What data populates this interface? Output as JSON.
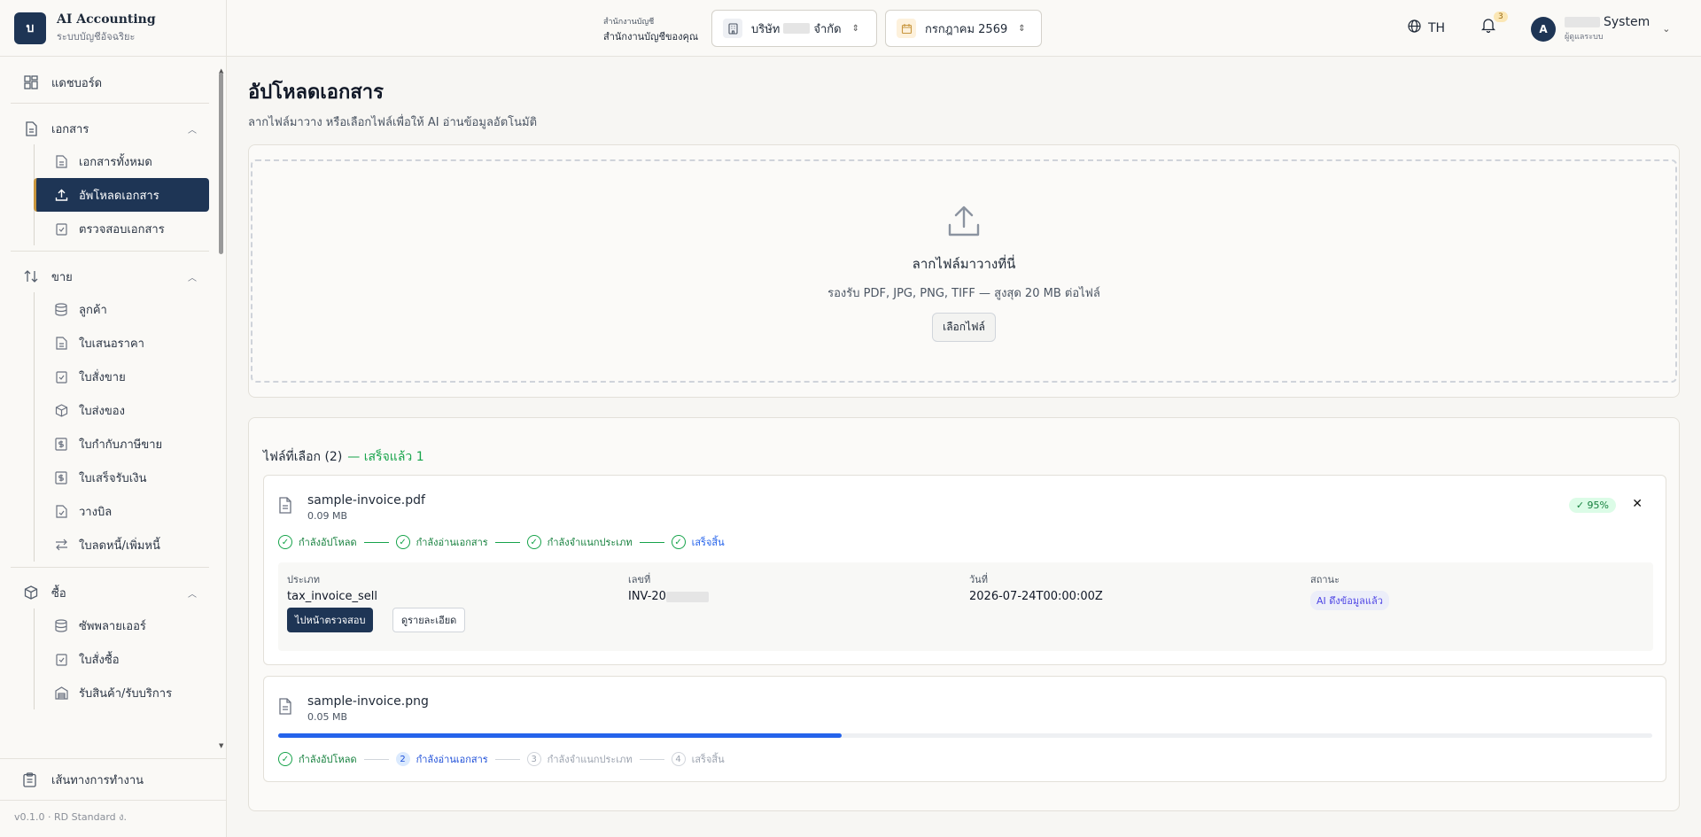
{
  "brand": {
    "logo": "บ",
    "title": "AI Accounting",
    "subtitle": "ระบบบัญชีอัจฉริยะ"
  },
  "sidebar": {
    "dashboard": "แดชบอร์ด",
    "documents": {
      "label": "เอกสาร",
      "items": [
        "เอกสารทั้งหมด",
        "อัพโหลดเอกสาร",
        "ตรวจสอบเอกสาร"
      ]
    },
    "sales": {
      "label": "ขาย",
      "items": [
        "ลูกค้า",
        "ใบเสนอราคา",
        "ใบสั่งขาย",
        "ใบส่งของ",
        "ใบกำกับภาษีขาย",
        "ใบเสร็จรับเงิน",
        "วางบิล",
        "ใบลดหนี้/เพิ่มหนี้"
      ]
    },
    "purchase": {
      "label": "ซื้อ",
      "items": [
        "ซัพพลายเออร์",
        "ใบสั่งซื้อ",
        "รับสินค้า/รับบริการ"
      ]
    },
    "workflow": "เส้นทางการทำงาน",
    "version": "v0.1.0 · RD Standard ง."
  },
  "header": {
    "office_label": "สำนักงานบัญชี",
    "office_name": "สำนักงานบัญชีของคุณ",
    "company_prefix": "บริษัท",
    "company_suffix": "จำกัด",
    "period": "กรกฎาคม 2569",
    "lang": "TH",
    "notif_count": "3",
    "avatar": "A",
    "user_name": "System",
    "user_role": "ผู้ดูแลระบบ"
  },
  "page": {
    "title": "อัปโหลดเอกสาร",
    "subtitle": "ลากไฟล์มาวาง หรือเลือกไฟล์เพื่อให้ AI อ่านข้อมูลอัตโนมัติ"
  },
  "dropzone": {
    "title": "ลากไฟล์มาวางที่นี่",
    "subtitle": "รองรับ PDF, JPG, PNG, TIFF — สูงสุด 20 MB ต่อไฟล์",
    "button": "เลือกไฟล์"
  },
  "files": {
    "heading": "ไฟล์ที่เลือก (2)",
    "done_text": "— เสร็จแล้ว 1",
    "items": [
      {
        "name": "sample-invoice.pdf",
        "size": "0.09 MB",
        "percent": "✓ 95%",
        "steps": [
          "กำลังอัปโหลด",
          "กำลังอ่านเอกสาร",
          "กำลังจำแนกประเภท",
          "เสร็จสิ้น"
        ],
        "details": {
          "type_label": "ประเภท",
          "type_value": "tax_invoice_sell",
          "number_label": "เลขที่",
          "number_value": "INV-20",
          "date_label": "วันที่",
          "date_value": "2026-07-24T00:00:00Z",
          "status_label": "สถานะ",
          "status_value": "AI ดึงข้อมูลแล้ว"
        },
        "primary_button": "ไปหน้าตรวจสอบ",
        "secondary_button": "ดูรายละเอียด"
      },
      {
        "name": "sample-invoice.png",
        "size": "0.05 MB",
        "progress": 0.41,
        "steps": [
          "กำลังอัปโหลด",
          "กำลังอ่านเอกสาร",
          "กำลังจำแนกประเภท",
          "เสร็จสิ้น"
        ],
        "step_numbers": [
          "2",
          "3",
          "4"
        ]
      }
    ]
  },
  "colors": {
    "navy": "#1e3555",
    "accent": "#c8963e",
    "success": "#16a34a",
    "progress": "#2563eb"
  }
}
